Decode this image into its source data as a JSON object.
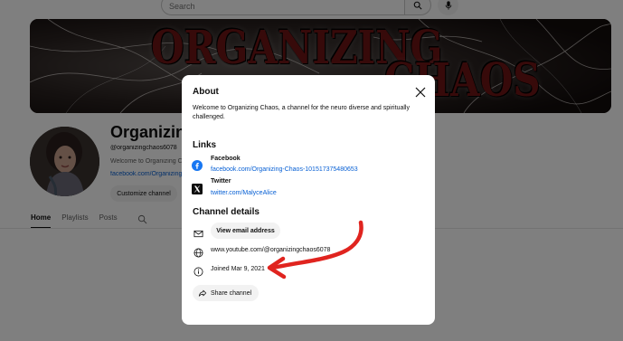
{
  "search": {
    "placeholder": "Search"
  },
  "banner": {
    "line1": "ORGANIZING",
    "line2": "CHAOS"
  },
  "channel": {
    "name": "Organizing Chaos",
    "handle": "@organizingchaos6078",
    "description": "Welcome to Organizing Chaos, a channel for the neuro diverse and spiritually challenged.",
    "link": "facebook.com/Organizing-Chaos-101517375480653",
    "customize_label": "Customize channel"
  },
  "tabs": [
    {
      "label": "Home"
    },
    {
      "label": "Playlists"
    },
    {
      "label": "Posts"
    }
  ],
  "about": {
    "title": "About",
    "description": "Welcome to Organizing Chaos, a channel for the neuro diverse and spiritually challenged.",
    "links_title": "Links",
    "links": [
      {
        "name": "Facebook",
        "url": "facebook.com/Organizing-Chaos-101517375480653",
        "icon": "facebook-icon"
      },
      {
        "name": "Twitter",
        "url": "twitter.com/MalyceAlice",
        "icon": "x-twitter-icon"
      }
    ],
    "details_title": "Channel details",
    "email_button": "View email address",
    "channel_url": "www.youtube.com/@organizingchaos6078",
    "joined": "Joined Mar 9, 2021",
    "share_label": "Share channel"
  },
  "colors": {
    "link": "#065fd4",
    "annotation": "#e0241f",
    "banner_text": "#6e1515"
  }
}
